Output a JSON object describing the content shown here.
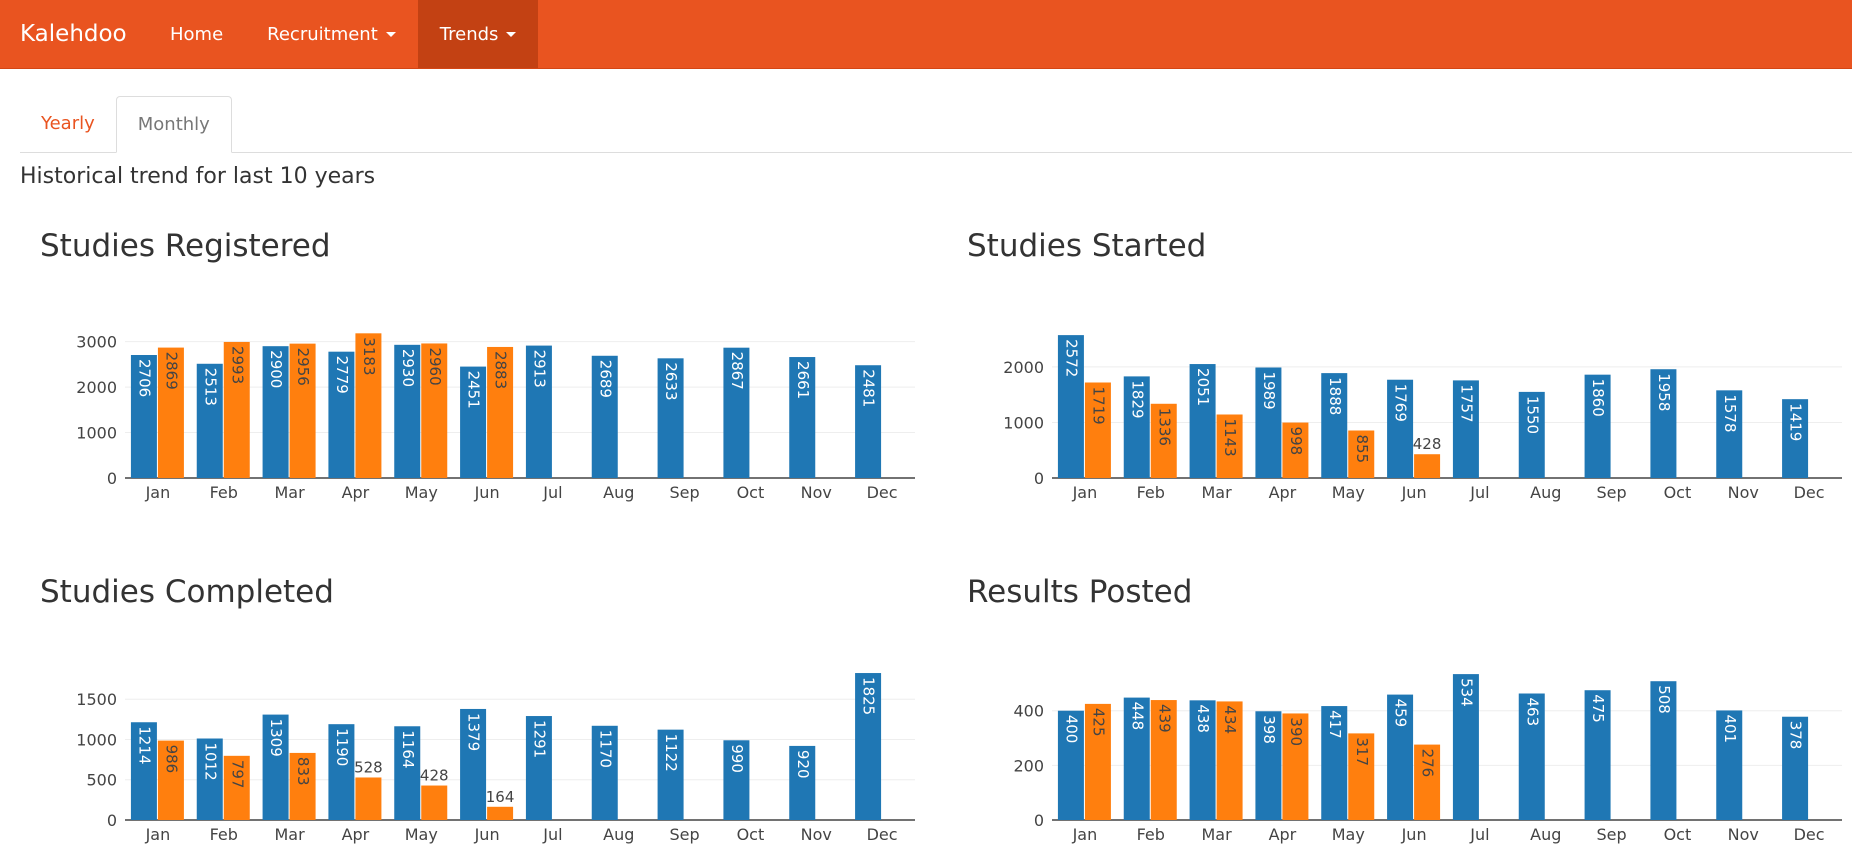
{
  "brand": "Kalehdoo",
  "nav": [
    {
      "label": "Home",
      "dropdown": false,
      "active": false
    },
    {
      "label": "Recruitment",
      "dropdown": true,
      "active": false
    },
    {
      "label": "Trends",
      "dropdown": true,
      "active": true
    }
  ],
  "tabs": [
    {
      "label": "Yearly",
      "active": false
    },
    {
      "label": "Monthly",
      "active": true
    }
  ],
  "subtitle": "Historical trend for last 10 years",
  "colors": {
    "navbar": "#e95420",
    "series_blue": "#1f77b4",
    "series_orange": "#ff7f0e"
  },
  "chart_data": [
    {
      "type": "bar",
      "title": "Studies Registered",
      "categories": [
        "Jan",
        "Feb",
        "Mar",
        "Apr",
        "May",
        "Jun",
        "Jul",
        "Aug",
        "Sep",
        "Oct",
        "Nov",
        "Dec"
      ],
      "ylim": [
        0,
        3300
      ],
      "yticks": [
        0,
        1000,
        2000,
        3000
      ],
      "series": [
        {
          "color": "#1f77b4",
          "values": [
            2706,
            2513,
            2900,
            2779,
            2930,
            2451,
            2913,
            2689,
            2633,
            2867,
            2661,
            2481
          ]
        },
        {
          "color": "#ff7f0e",
          "values": [
            2869,
            2993,
            2956,
            3183,
            2960,
            2883,
            null,
            null,
            null,
            null,
            null,
            null
          ]
        }
      ]
    },
    {
      "type": "bar",
      "title": "Studies Started",
      "categories": [
        "Jan",
        "Feb",
        "Mar",
        "Apr",
        "May",
        "Jun",
        "Jul",
        "Aug",
        "Sep",
        "Oct",
        "Nov",
        "Dec"
      ],
      "ylim": [
        0,
        2700
      ],
      "yticks": [
        0,
        1000,
        2000
      ],
      "series": [
        {
          "color": "#1f77b4",
          "values": [
            2572,
            1829,
            2051,
            1989,
            1888,
            1769,
            1757,
            1550,
            1860,
            1958,
            1578,
            1419
          ]
        },
        {
          "color": "#ff7f0e",
          "values": [
            1719,
            1336,
            1143,
            998,
            855,
            428,
            null,
            null,
            null,
            null,
            null,
            null
          ]
        }
      ]
    },
    {
      "type": "bar",
      "title": "Studies Completed",
      "categories": [
        "Jan",
        "Feb",
        "Mar",
        "Apr",
        "May",
        "Jun",
        "Jul",
        "Aug",
        "Sep",
        "Oct",
        "Nov",
        "Dec"
      ],
      "ylim": [
        0,
        1900
      ],
      "yticks": [
        0,
        500,
        1000,
        1500
      ],
      "series": [
        {
          "color": "#1f77b4",
          "values": [
            1214,
            1012,
            1309,
            1190,
            1164,
            1379,
            1291,
            1170,
            1122,
            990,
            920,
            1825
          ]
        },
        {
          "color": "#ff7f0e",
          "values": [
            986,
            797,
            833,
            528,
            428,
            164,
            null,
            null,
            null,
            null,
            null,
            null
          ]
        }
      ]
    },
    {
      "type": "bar",
      "title": "Results Posted",
      "categories": [
        "Jan",
        "Feb",
        "Mar",
        "Apr",
        "May",
        "Jun",
        "Jul",
        "Aug",
        "Sep",
        "Oct",
        "Nov",
        "Dec"
      ],
      "ylim": [
        0,
        560
      ],
      "yticks": [
        0,
        200,
        400
      ],
      "series": [
        {
          "color": "#1f77b4",
          "values": [
            400,
            448,
            438,
            398,
            417,
            459,
            534,
            463,
            475,
            508,
            401,
            378
          ]
        },
        {
          "color": "#ff7f0e",
          "values": [
            425,
            439,
            434,
            390,
            317,
            276,
            null,
            null,
            null,
            null,
            null,
            null
          ]
        }
      ]
    }
  ]
}
